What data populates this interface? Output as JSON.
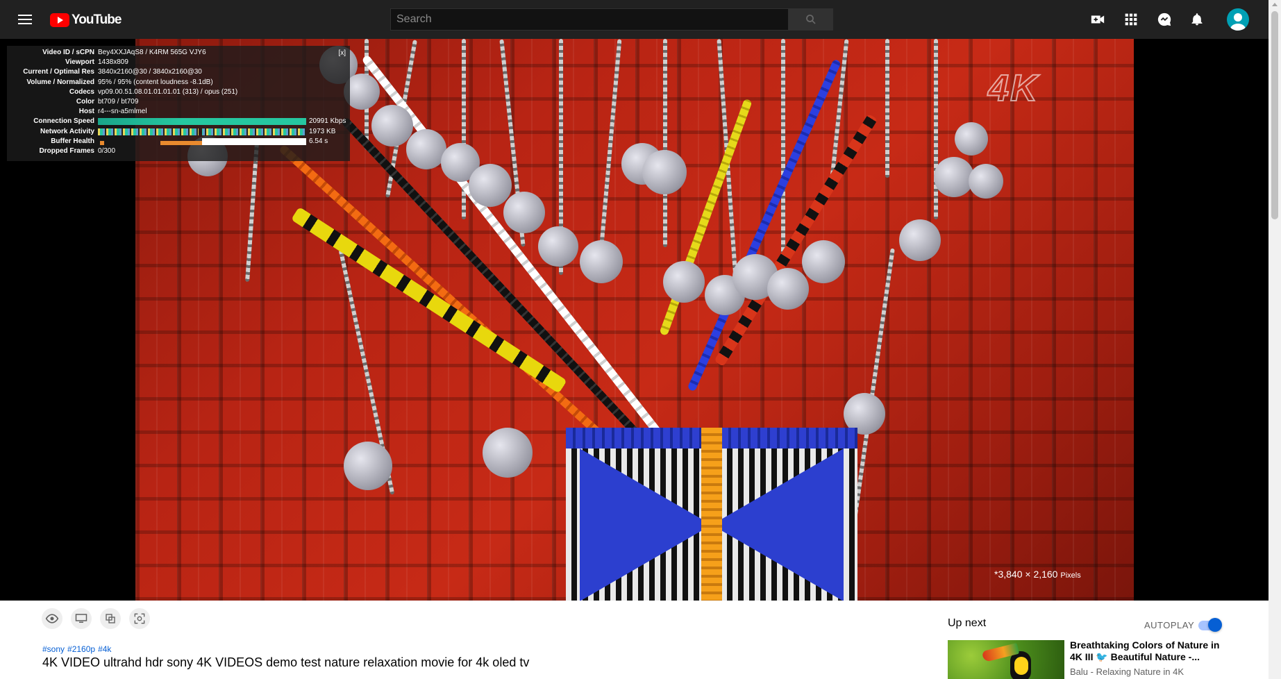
{
  "header": {
    "logo_text": "YouTube",
    "search_placeholder": "Search"
  },
  "stats_overlay": {
    "close_label": "[x]",
    "rows": [
      {
        "key": "Video ID / sCPN",
        "value": "Bey4XXJAqS8 / K4RM 565G VJY6"
      },
      {
        "key": "Viewport",
        "value": "1438x809"
      },
      {
        "key": "Current / Optimal Res",
        "value": "3840x2160@30 / 3840x2160@30"
      },
      {
        "key": "Volume / Normalized",
        "value": "95% / 95% (content loudness -8.1dB)"
      },
      {
        "key": "Codecs",
        "value": "vp09.00.51.08.01.01.01.01 (313) / opus (251)"
      },
      {
        "key": "Color",
        "value": "bt709 / bt709"
      },
      {
        "key": "Host",
        "value": "r4---sn-a5mlmel"
      },
      {
        "key": "Connection Speed",
        "value": "20991 Kbps"
      },
      {
        "key": "Network Activity",
        "value": "1973 KB"
      },
      {
        "key": "Buffer Health",
        "value": "6.54 s"
      },
      {
        "key": "Dropped Frames",
        "value": "0/300"
      }
    ]
  },
  "video": {
    "watermark": "4K",
    "resolution_note": "*3,840 × 2,160",
    "resolution_unit": "Pixels"
  },
  "below_player": {
    "hashtags": [
      "#sony",
      "#2160p",
      "#4k"
    ],
    "title": "4K VIDEO ultrahd hdr sony 4K VIDEOS demo test nature relaxation movie for 4k oled tv"
  },
  "sidebar": {
    "up_next_label": "Up next",
    "autoplay_label": "AUTOPLAY",
    "autoplay_on": true,
    "recommendations": [
      {
        "title": "Breathtaking Colors of Nature in 4K III 🐦 Beautiful Nature -...",
        "channel": "Balu - Relaxing Nature in 4K"
      }
    ]
  },
  "colors": {
    "topbar": "#212121",
    "logo_red": "#ff0000",
    "link_blue": "#065fd4",
    "stats_green": "#26c7a0"
  }
}
